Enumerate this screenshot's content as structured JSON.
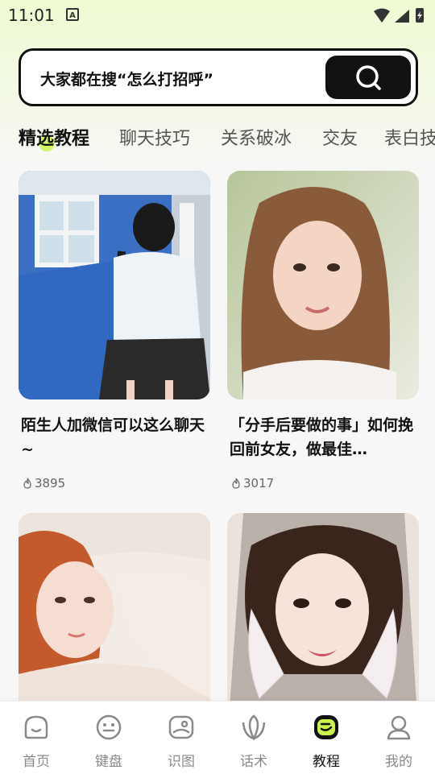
{
  "status": {
    "time": "11:01",
    "notif_letter": "A"
  },
  "search": {
    "text": "大家都在搜“怎么打招呼”"
  },
  "tabs": [
    "精选教程",
    "聊天技巧",
    "关系破冰",
    "交友",
    "表白技"
  ],
  "cards": [
    {
      "title": "陌生人加微信可以这么聊天~",
      "likes": "3895"
    },
    {
      "title": "「分手后要做的事」如何挽回前女友，做最佳…",
      "likes": "3017"
    },
    {
      "title": "",
      "likes": ""
    },
    {
      "title": "",
      "likes": ""
    }
  ],
  "nav": [
    "首页",
    "键盘",
    "识图",
    "话术",
    "教程",
    "我的"
  ],
  "colors": {
    "accent": "#c9f24a",
    "dark": "#111111"
  }
}
